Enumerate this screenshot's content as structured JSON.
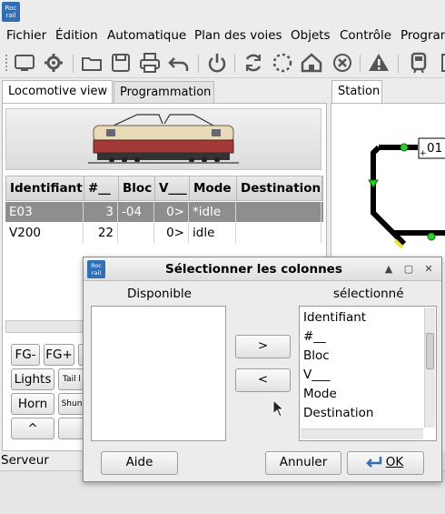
{
  "menubar": [
    "Fichier",
    "Édition",
    "Automatique",
    "Plan des voies",
    "Objets",
    "Contrôle",
    "Program"
  ],
  "logo_text": "Roc rail",
  "toolbar_icons": [
    "panel-icon",
    "gear-icon",
    "folder-icon",
    "save-icon",
    "print-icon",
    "undo-icon",
    "power-icon",
    "refresh-icon",
    "spinner-icon",
    "home-icon",
    "stop-icon",
    "warning-icon",
    "train-icon",
    "side-icon"
  ],
  "tabs": {
    "loco": "Locomotive view",
    "prog": "Programmation",
    "station": "Station"
  },
  "table": {
    "headers": [
      "Identifiant",
      "#__",
      "Bloc",
      "V___",
      "Mode",
      "Destination"
    ],
    "rows": [
      [
        "E03",
        "3",
        "-04",
        "0>",
        "*idle",
        ""
      ],
      [
        "V200",
        "22",
        "",
        "0>",
        "idle",
        ""
      ]
    ]
  },
  "controls": {
    "fg_minus": "FG-",
    "fg_plus": "FG+",
    "lights": "Lights",
    "tail": "Tail l",
    "horn": "Horn",
    "shunt": "Shun",
    "up": "^"
  },
  "serveur": "Serveur",
  "station_label": "01",
  "dialog": {
    "title": "Sélectionner les colonnes",
    "available_label": "Disponible",
    "selected_label": "sélectionné",
    "available_items": [],
    "selected_items": [
      "Identifiant",
      "#__",
      "Bloc",
      "V___",
      "Mode",
      "Destination"
    ],
    "add_button": ">",
    "remove_button": "<",
    "help_button": "Aide",
    "cancel_button": "Annuler",
    "ok_button": "OK"
  }
}
